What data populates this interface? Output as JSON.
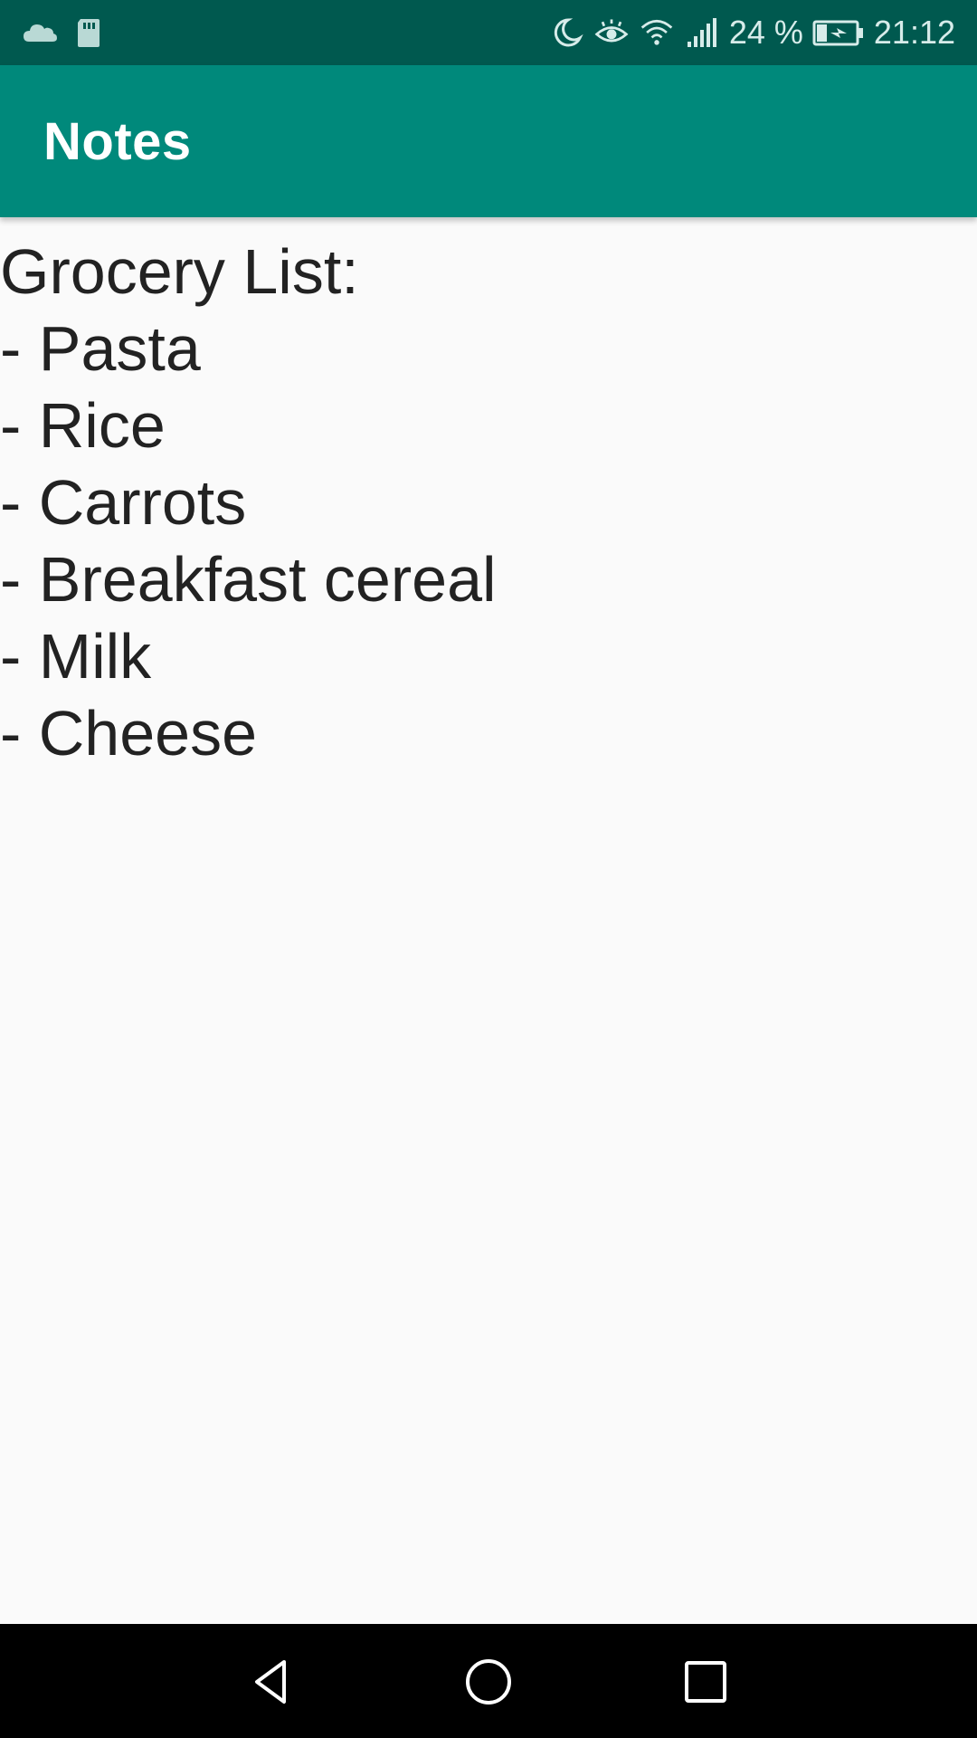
{
  "status_bar": {
    "time": "21:12",
    "battery_percent": "24 %",
    "icons": {
      "left": [
        "cloud-icon",
        "sd-card-icon"
      ],
      "right": [
        "moon-icon",
        "eye-icon",
        "wifi-icon",
        "signal-icon",
        "battery-charging-icon"
      ]
    }
  },
  "app_bar": {
    "title": "Notes",
    "color": "#00897b",
    "status_color": "#00594f"
  },
  "note": {
    "lines": [
      "Grocery List:",
      "- Pasta",
      "- Rice",
      "- Carrots",
      "- Breakfast cereal",
      "- Milk",
      "- Cheese"
    ]
  },
  "nav_bar": {
    "buttons": [
      "back-icon",
      "home-icon",
      "recents-icon"
    ]
  }
}
